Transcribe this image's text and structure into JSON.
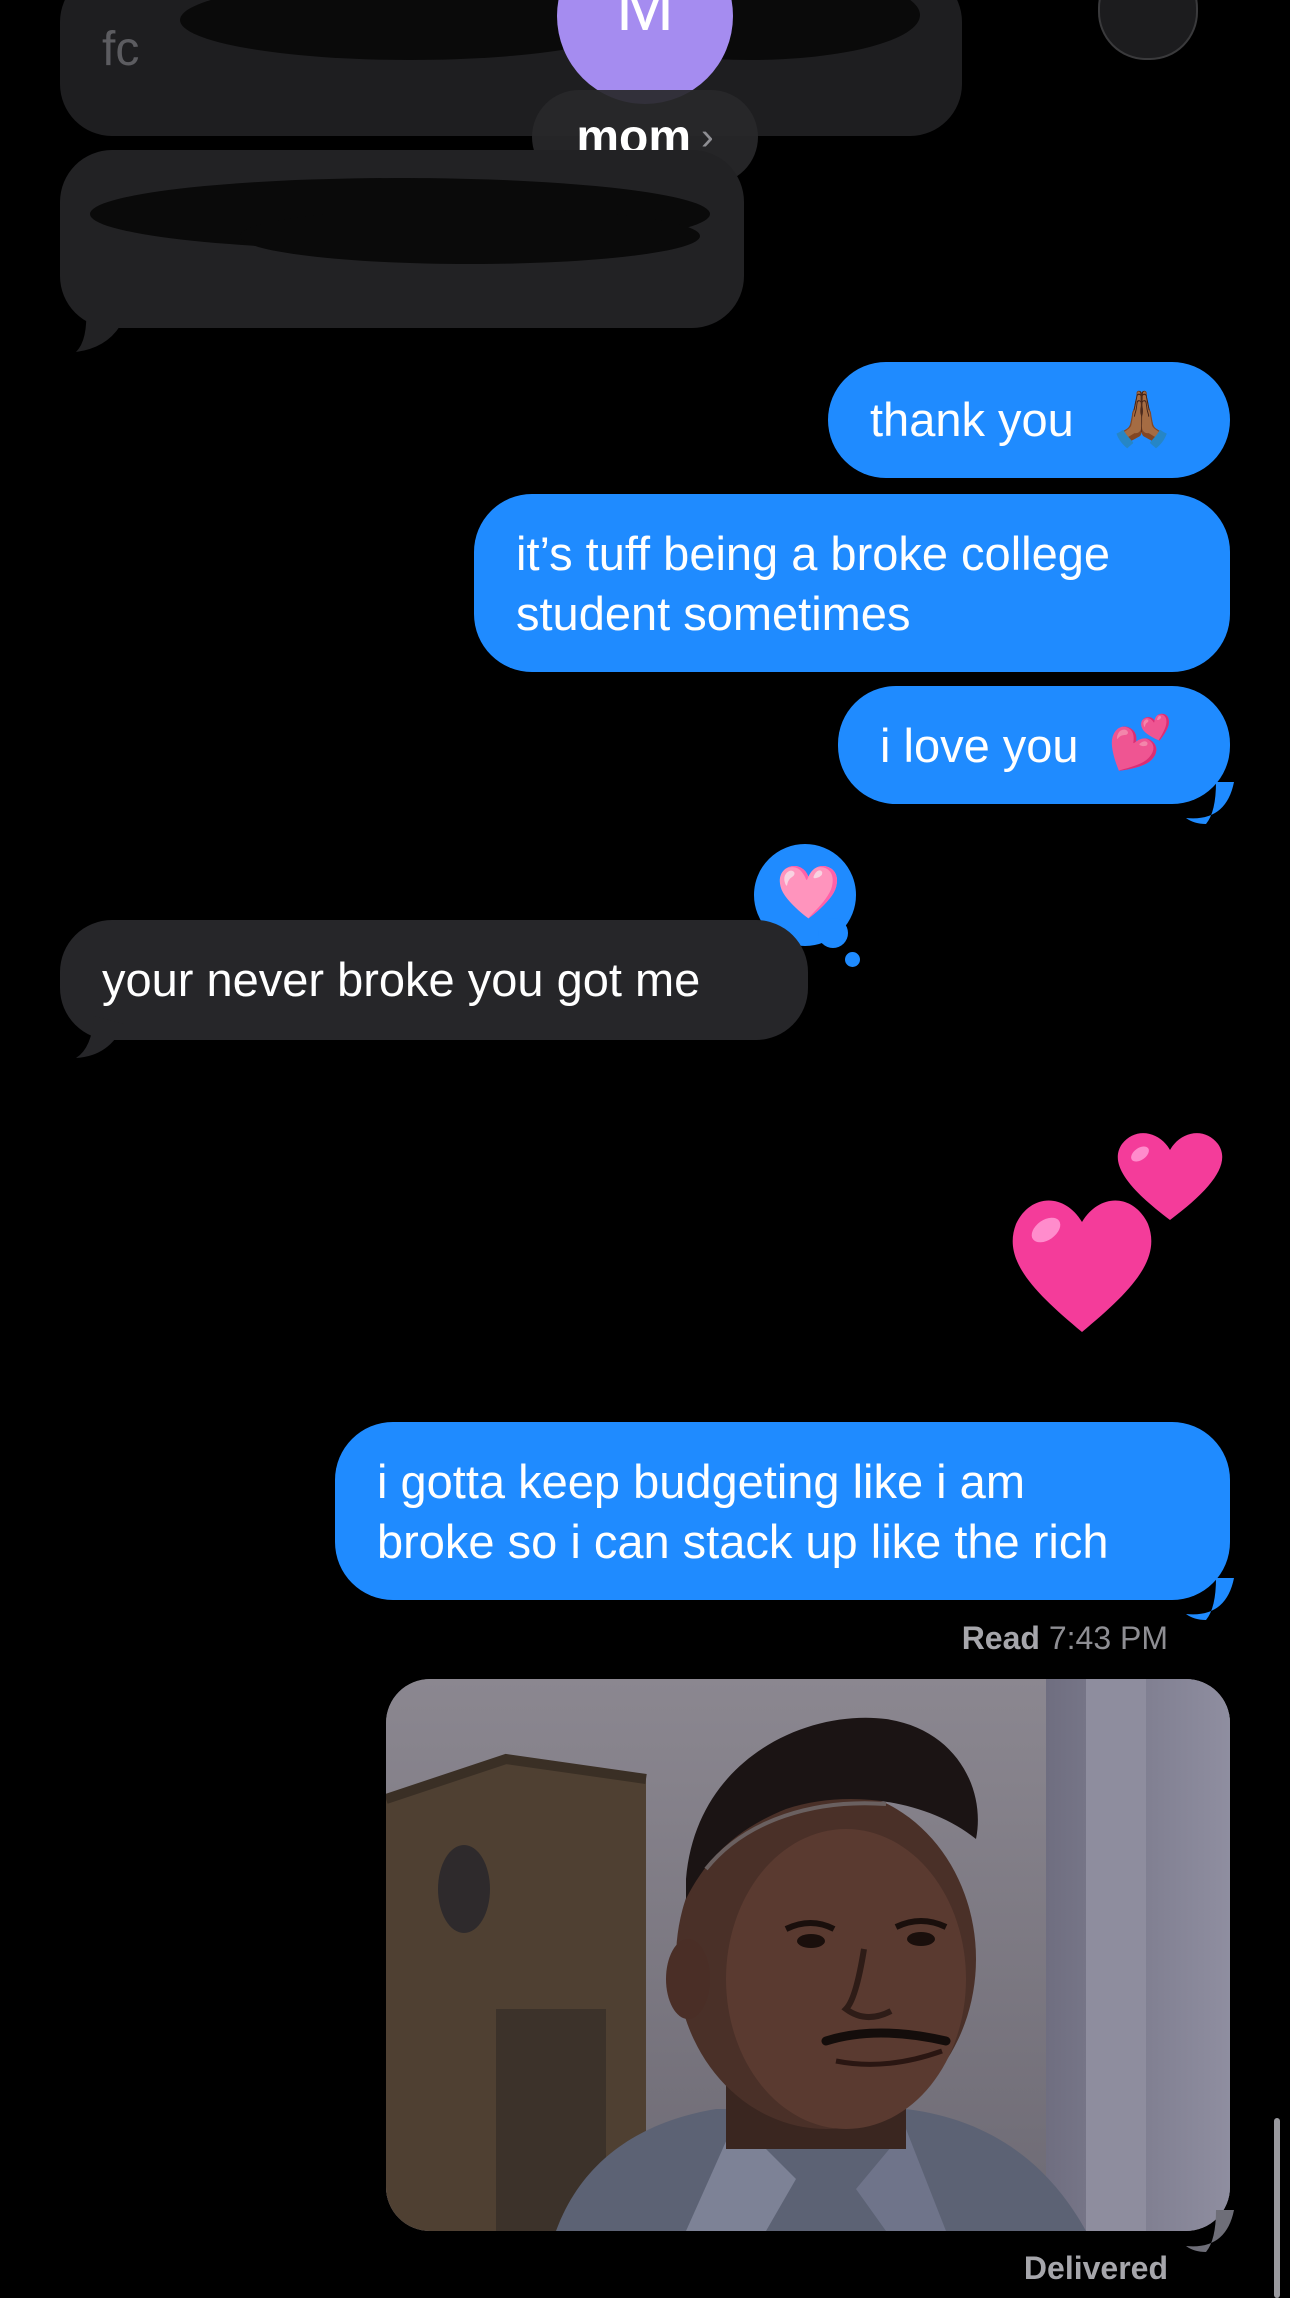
{
  "header": {
    "avatar_initial": "M",
    "contact_name": "mom",
    "chevron": "›",
    "partial_text": "fc"
  },
  "messages": {
    "sent_1": "thank you",
    "sent_1_emoji": "🙏🏾",
    "sent_2": "it’s tuff being a broke college\nstudent sometimes",
    "sent_3": "i love you",
    "sent_3_emoji": "💕",
    "tapback_emoji": "🩷",
    "received_1": "your never broke you got me",
    "sent_hearts_emoji": "💕",
    "sent_4": "i gotta keep budgeting like i am\nbroke so i can stack up like the rich"
  },
  "status": {
    "read_label": "Read",
    "read_time": "7:43 PM",
    "delivered_label": "Delivered"
  },
  "icons": {
    "back": "back-chevron-icon",
    "video": "video-camera-icon"
  },
  "colors": {
    "sent_bubble": "#1f8bff",
    "received_bubble": "#262629",
    "avatar": "#a58cf0",
    "background": "#000000"
  }
}
